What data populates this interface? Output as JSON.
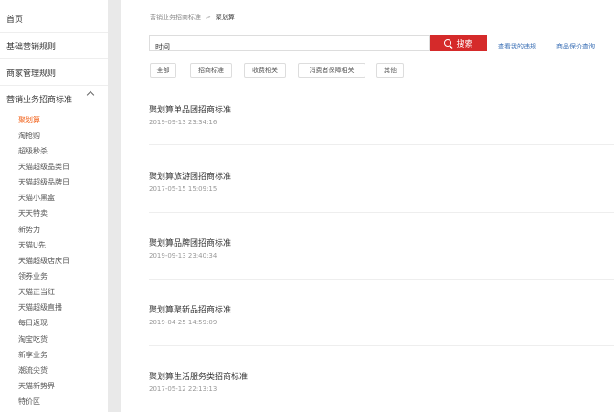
{
  "sidebar": {
    "items": [
      {
        "label": "首页"
      },
      {
        "label": "基础营销规则"
      },
      {
        "label": "商家管理规则"
      },
      {
        "label": "营销业务招商标准"
      }
    ],
    "subitems": [
      {
        "label": "聚划算",
        "active": true
      },
      {
        "label": "淘抢购"
      },
      {
        "label": "超级秒杀"
      },
      {
        "label": "天猫超级品类日"
      },
      {
        "label": "天猫超级品牌日"
      },
      {
        "label": "天猫小黑盒"
      },
      {
        "label": "天天特卖"
      },
      {
        "label": "新势力"
      },
      {
        "label": "天猫U先"
      },
      {
        "label": "天猫超级店庆日"
      },
      {
        "label": "领券业务"
      },
      {
        "label": "天猫正当红"
      },
      {
        "label": "天猫超级直播"
      },
      {
        "label": "每日返现"
      },
      {
        "label": "淘宝吃货"
      },
      {
        "label": "新享业务"
      },
      {
        "label": "潮流尖货"
      },
      {
        "label": "天猫新势界"
      },
      {
        "label": "特价区"
      }
    ]
  },
  "breadcrumb": {
    "parent": "营销业务招商标准",
    "separator": ">",
    "current": "聚划算"
  },
  "search": {
    "value": "时间",
    "button_label": "搜索"
  },
  "links": {
    "violations": "查看我的违规",
    "price_protect": "商品保价查询"
  },
  "tags": [
    "全部",
    "招商标准",
    "收费相关",
    "消费者保障相关",
    "其他"
  ],
  "articles": [
    {
      "title": "聚划算单品团招商标准",
      "date": "2019-09-13 23:34:16"
    },
    {
      "title": "聚划算旅游团招商标准",
      "date": "2017-05-15 15:09:15"
    },
    {
      "title": "聚划算品牌团招商标准",
      "date": "2019-09-13 23:40:34"
    },
    {
      "title": "聚划算聚新品招商标准",
      "date": "2019-04-25 14:59:09"
    },
    {
      "title": "聚划算生活服务类招商标准",
      "date": "2017-05-12 22:13:13"
    }
  ],
  "colors": {
    "accent": "#f2641e",
    "search": "#d52a2a",
    "link": "#3a6fb5"
  }
}
